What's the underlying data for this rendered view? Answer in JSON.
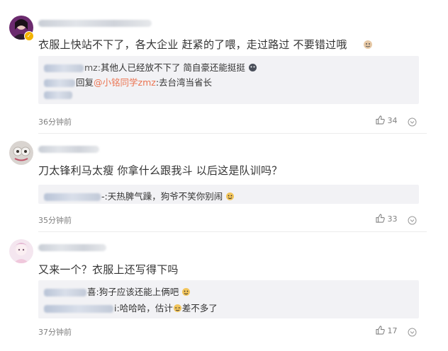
{
  "comments": [
    {
      "text": "衣服上快站不下了，各大企业 赶紧的了喂，走过路过 不要错过哦",
      "replies": [
        {
          "name_suffix": "mz:",
          "text": "其他人已经放不下了 简自豪还能挺挺"
        },
        {
          "name_suffix": "回复",
          "mention": "@小铭同学zmz",
          "text": ":去台湾当省长"
        }
      ],
      "time": "36分钟前",
      "likes": "34"
    },
    {
      "text": "刀太锋利马太瘦 你拿什么跟我斗 以后这是队训吗？",
      "replies": [
        {
          "name_suffix": "-:",
          "text": "天热脾气躁，狗爷不笑你别闹"
        }
      ],
      "time": "35分钟前",
      "likes": "33"
    },
    {
      "text": "又来一个？衣服上还写得下吗",
      "replies": [
        {
          "name_suffix": "喜:",
          "text": "狗子应该还能上俩吧"
        },
        {
          "name_suffix": "i:",
          "text": "哈哈哈，估计",
          "text2": "差不多了"
        }
      ],
      "time": "37分钟前",
      "likes": "17"
    }
  ],
  "colors": {
    "accent": "#eb7350",
    "muted": "#808080",
    "reply_bg": "#f2f2f5"
  },
  "icons": {
    "like": "thumbs-up-icon",
    "more": "chevron-down-icon",
    "verified": "verified-badge-icon"
  }
}
